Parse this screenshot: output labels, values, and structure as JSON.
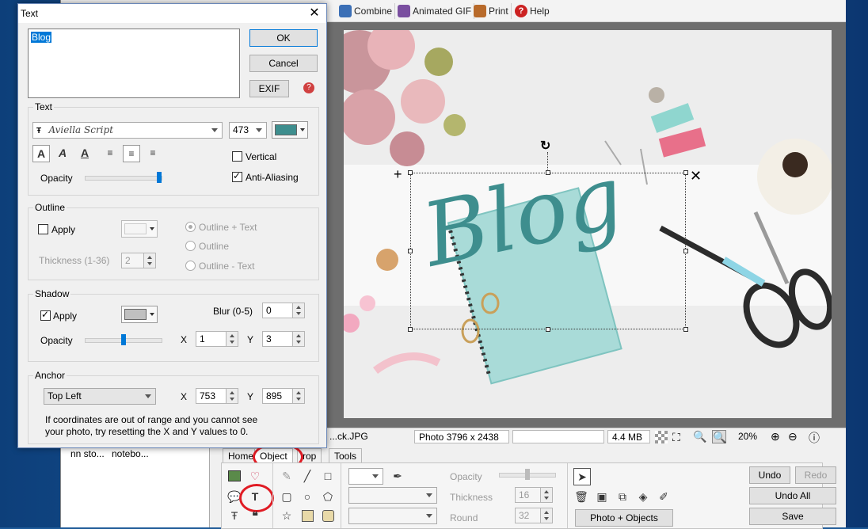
{
  "toolbar": {
    "items": [
      {
        "label": "Combine",
        "icon": "combine-icon",
        "color": "#3b6fb6"
      },
      {
        "label": "Animated GIF",
        "icon": "animated-gif-icon",
        "color": "#7a4fa0"
      },
      {
        "label": "Print",
        "icon": "printer-icon",
        "color": "#b86a2a"
      },
      {
        "label": "Help",
        "icon": "help-icon",
        "color": "#cc2222"
      }
    ]
  },
  "photo": {
    "overlay_text": "Blog",
    "text_color": "#3e8e8e"
  },
  "status": {
    "filename": "...ck.JPG",
    "dimensions": "Photo 3796 x 2438",
    "size": "4.4 MB",
    "zoom": "20%"
  },
  "left_panel": {
    "items": [
      "nn sto...",
      "notebo..."
    ]
  },
  "tabs": [
    {
      "label": "Home",
      "active": false
    },
    {
      "label": "Object",
      "active": true
    },
    {
      "label": "rop",
      "active": false
    },
    {
      "label": "Tools",
      "active": false
    }
  ],
  "object_panel": {
    "opacity_label": "Opacity",
    "thickness_label": "Thickness",
    "thickness_value": "16",
    "round_label": "Round",
    "round_value": "32",
    "photo_objects_button": "Photo + Objects",
    "undo": "Undo",
    "redo": "Redo",
    "undo_all": "Undo All",
    "save": "Save"
  },
  "dialog": {
    "title": "Text",
    "text_value": "Blog",
    "ok": "OK",
    "cancel": "Cancel",
    "exif": "EXIF",
    "text_group": {
      "label": "Text",
      "font": "Aviella Script",
      "size": "473",
      "color": "#3e8e8e",
      "vertical": "Vertical",
      "vertical_checked": false,
      "anti_aliasing": "Anti-Aliasing",
      "anti_aliasing_checked": true,
      "opacity_label": "Opacity",
      "opacity_value": 1.0
    },
    "outline_group": {
      "label": "Outline",
      "apply": "Apply",
      "apply_checked": false,
      "thickness_label": "Thickness (1-36)",
      "thickness_value": "2",
      "options": [
        "Outline + Text",
        "Outline",
        "Outline - Text"
      ],
      "selected": "Outline + Text"
    },
    "shadow_group": {
      "label": "Shadow",
      "apply": "Apply",
      "apply_checked": true,
      "color": "#c0c0c0",
      "blur_label": "Blur (0-5)",
      "blur_value": "0",
      "opacity_label": "Opacity",
      "opacity_value": 0.5,
      "x_label": "X",
      "x_value": "1",
      "y_label": "Y",
      "y_value": "3"
    },
    "anchor_group": {
      "label": "Anchor",
      "position": "Top Left",
      "x_label": "X",
      "x_value": "753",
      "y_label": "Y",
      "y_value": "895",
      "note_line1": "If coordinates are out of range and you cannot see",
      "note_line2": "your photo, try resetting the X and Y values to 0."
    }
  },
  "annotation_color": "#e01b24"
}
